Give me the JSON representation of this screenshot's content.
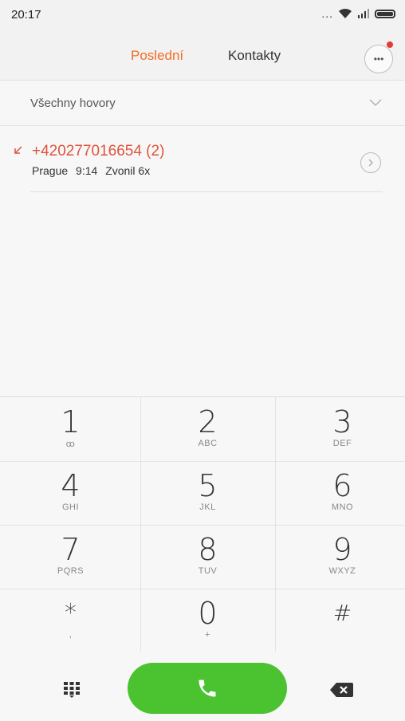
{
  "status_bar": {
    "time": "20:17",
    "more_indicator": "...",
    "icons": [
      "wifi-icon",
      "signal-icon",
      "battery-icon"
    ]
  },
  "header": {
    "tabs": [
      {
        "label": "Poslední",
        "active": true
      },
      {
        "label": "Kontakty",
        "active": false
      }
    ],
    "more_icon": "more-options-icon",
    "more_glyph": "•••",
    "notification_dot_color": "#e53935"
  },
  "filter": {
    "label": "Všechny hovory",
    "icon": "chevron-down-icon"
  },
  "calls": [
    {
      "number": "+420277016654 (2)",
      "location": "Prague",
      "time": "9:14",
      "status": "Zvonil 6x",
      "type_icon": "missed-call-icon",
      "action_icon": "chevron-right-icon"
    }
  ],
  "keypad": {
    "keys": [
      {
        "digit": "1",
        "letters": "ꝏ"
      },
      {
        "digit": "2",
        "letters": "ABC"
      },
      {
        "digit": "3",
        "letters": "DEF"
      },
      {
        "digit": "4",
        "letters": "GHI"
      },
      {
        "digit": "5",
        "letters": "JKL"
      },
      {
        "digit": "6",
        "letters": "MNO"
      },
      {
        "digit": "7",
        "letters": "PQRS"
      },
      {
        "digit": "8",
        "letters": "TUV"
      },
      {
        "digit": "9",
        "letters": "WXYZ"
      },
      {
        "digit": "*",
        "letters": ","
      },
      {
        "digit": "0",
        "letters": "+"
      },
      {
        "digit": "#",
        "letters": ""
      }
    ]
  },
  "bottom": {
    "dialpad_icon": "dialpad-icon",
    "call_icon": "phone-icon",
    "call_color": "#4bc22f",
    "backspace_icon": "backspace-icon"
  },
  "colors": {
    "accent": "#f36c21",
    "missed": "#e0533d"
  }
}
